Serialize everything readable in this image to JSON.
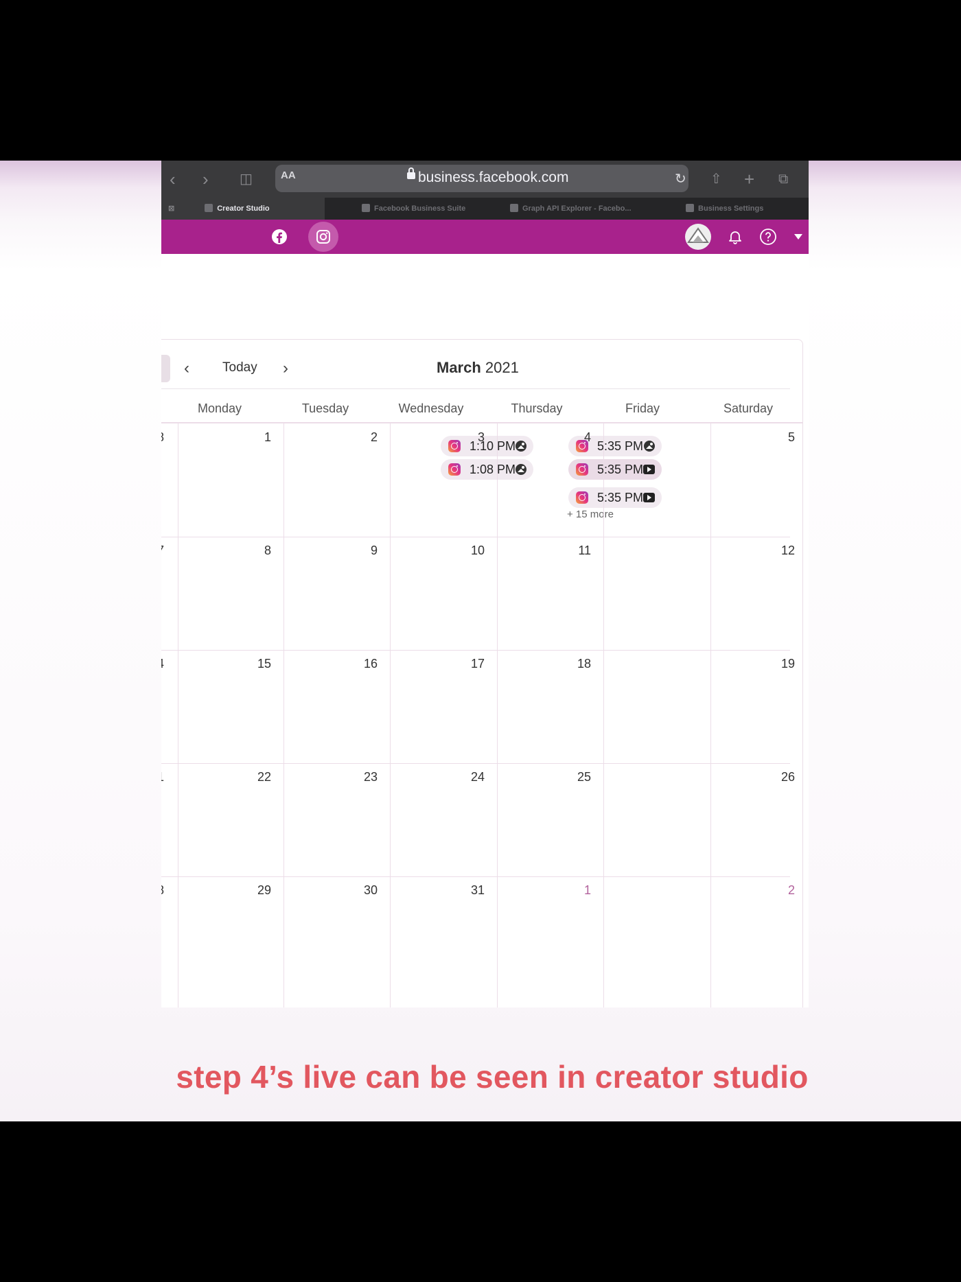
{
  "browser": {
    "text_size_label": "AA",
    "url": "business.facebook.com",
    "tabs": [
      {
        "label": "Creator Studio",
        "active": true
      },
      {
        "label": "Facebook Business Suite",
        "active": false
      },
      {
        "label": "Graph API Explorer - Facebo...",
        "active": false
      },
      {
        "label": "Business Settings",
        "active": false
      }
    ]
  },
  "appbar": {
    "color": "#a8228c",
    "platforms": [
      "facebook-icon",
      "instagram-icon"
    ],
    "right_icons": [
      "avatar",
      "bell-icon",
      "help-icon",
      "caret-down-icon"
    ]
  },
  "calendar": {
    "today_label": "Today",
    "month": "March",
    "year": "2021",
    "weekdays": [
      "Monday",
      "Tuesday",
      "Wednesday",
      "Thursday",
      "Friday",
      "Saturday"
    ],
    "weeks": [
      {
        "edge": "8",
        "days": [
          "1",
          "2",
          "3",
          "4",
          "5"
        ]
      },
      {
        "edge": "7",
        "days": [
          "8",
          "9",
          "10",
          "11",
          "12"
        ]
      },
      {
        "edge": "4",
        "days": [
          "15",
          "16",
          "17",
          "18",
          "19"
        ]
      },
      {
        "edge": "1",
        "days": [
          "22",
          "23",
          "24",
          "25",
          "26"
        ]
      },
      {
        "edge": "8",
        "days": [
          "29",
          "30",
          "31",
          "1",
          "2"
        ]
      }
    ],
    "events": {
      "thursday_3": [
        {
          "time": "1:10 PM",
          "type": "photo"
        },
        {
          "time": "1:08 PM",
          "type": "photo"
        }
      ],
      "friday_4": [
        {
          "time": "5:35 PM",
          "type": "photo"
        },
        {
          "time": "5:35 PM",
          "type": "video"
        },
        {
          "time": "5:35 PM",
          "type": "video"
        }
      ]
    },
    "more_label": "+ 15 more"
  },
  "caption": "step 4’s live can be seen in creator studio"
}
